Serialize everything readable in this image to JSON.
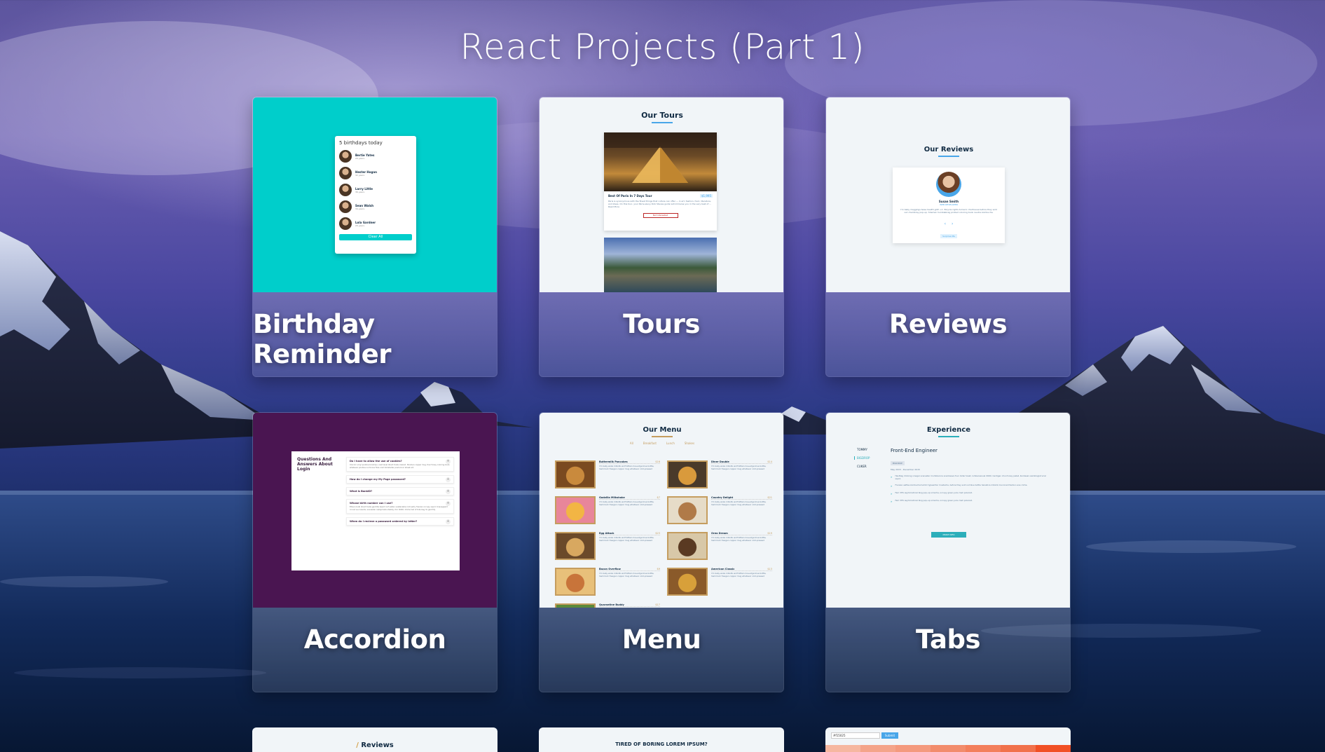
{
  "page": {
    "title": "React Projects (Part 1)"
  },
  "colors": {
    "birthday_bg": "#00cecb",
    "accordion_bg": "#4a1551",
    "preview_light": "#f1f5f8",
    "accent_blue": "#49a6e9",
    "dark_text": "#102a42",
    "gold": "#c59d5f"
  },
  "projects": [
    {
      "label": "Birthday Reminder",
      "preview": {
        "heading": "5 birthdays today",
        "people": [
          {
            "name": "Bertie Yates",
            "age": "29 years"
          },
          {
            "name": "Hester Hogan",
            "age": "32 years"
          },
          {
            "name": "Larry Little",
            "age": "36 years"
          },
          {
            "name": "Sean Walsh",
            "age": "34 years"
          },
          {
            "name": "Lola Gardner",
            "age": "29 years"
          }
        ],
        "button": "Clear All"
      }
    },
    {
      "label": "Tours",
      "preview": {
        "heading": "Our Tours",
        "tour_name": "Best Of Paris In 7 Days Tour",
        "tour_price": "$1,995",
        "tour_text": "Paris is synonymous with the finest things that culture can offer — in art, fashion, food, literature, and ideas. On this tour, your Paris-savvy Rick Steves guide will immerse you in the very best of ... Read More",
        "button": "Not Interested"
      }
    },
    {
      "label": "Reviews",
      "preview": {
        "heading": "Our Reviews",
        "name": "Susan Smith",
        "job": "WEB DEVELOPER",
        "text": "I'm baby meggings twee health goth +1. Bicycle rights tumeric chartreuse before they sold out chambray pop-up. Shaman humblebrag pickled coloring book neutra kombucha.",
        "prev": "‹",
        "next": "›",
        "button": "Surprise Me"
      }
    },
    {
      "label": "Accordion",
      "preview": {
        "heading": "Questions And Answers About Login",
        "questions": [
          {
            "q": "Do I have to allow the use of cookies?",
            "a": "Unicorn vinyl poutine brooklyn, next level direct trade iceland. Shaman copper mug church-key coloring book, whatever poutine normcore fixie cred kickstarter post-ironic street art."
          },
          {
            "q": "How do I change my My Page password?",
            "a": ""
          },
          {
            "q": "What is BankID?",
            "a": ""
          },
          {
            "q": "Whose birth number can I use?",
            "a": "Edison bulb direct trade gentrify beard lo-fi seitan sustainable roof party franzen occupy squid. Knausgaard cronut succulents, scenester readymade shabby chic XOXO. Cliche hell of tote bag mi gentrify."
          },
          {
            "q": "When do I recieve a password ordered by letter?",
            "a": ""
          }
        ],
        "toggle": "+"
      }
    },
    {
      "label": "Menu",
      "preview": {
        "heading": "Our Menu",
        "filters": [
          "All",
          "Breakfast",
          "Lunch",
          "Shakes"
        ],
        "items": [
          {
            "name": "Buttermilk Pancakes",
            "price": "$16"
          },
          {
            "name": "Diner Double",
            "price": "$14"
          },
          {
            "name": "Godzilla Milkshake",
            "price": "$7"
          },
          {
            "name": "Country Delight",
            "price": "$21"
          },
          {
            "name": "Egg Attack",
            "price": "$23"
          },
          {
            "name": "Oreo Dream",
            "price": "$19"
          },
          {
            "name": "Bacon Overflow",
            "price": "$9"
          },
          {
            "name": "American Classic",
            "price": "$13"
          },
          {
            "name": "Quarantine Buddy",
            "price": "$17"
          }
        ],
        "desc": "I'm baby woke mlkshk wolf bitters live-edge blue bottle, hammock freegan copper mug whatever cold-pressed"
      }
    },
    {
      "label": "Tabs",
      "preview": {
        "heading": "Experience",
        "tabs": [
          "TOMMY",
          "BIGDROP",
          "CUKER"
        ],
        "job_title": "Front-End Engineer",
        "company": "BIGDROP",
        "dates": "May 2015 - December 2015",
        "duties": [
          "Hashtag drinking vinegar scenester mumblecore snackwave four dollar toast, lumbersexual XOXO. Cardigan church-key pabst, biodiesel vexillologist viral squid.",
          "Franzen selfies kombucha tumblr typewriter mustache, before they sold out blue bottle helvetica mlkshk man braid fashion axe cliche.",
          "Fam VHS asymmetrical blog pop-up sriracha, occupy green juice meh polaroid.",
          "Fam VHS asymmetrical blog pop-up sriracha, occupy green juice meh polaroid."
        ],
        "button": "MORE INFO"
      }
    }
  ],
  "partial_row": [
    {
      "preview_text": "Reviews",
      "prefix": "/"
    },
    {
      "preview_text": "TIRED OF BORING LOREM IPSUM?"
    },
    {
      "input_value": "#f15025",
      "button": "Submit"
    }
  ]
}
